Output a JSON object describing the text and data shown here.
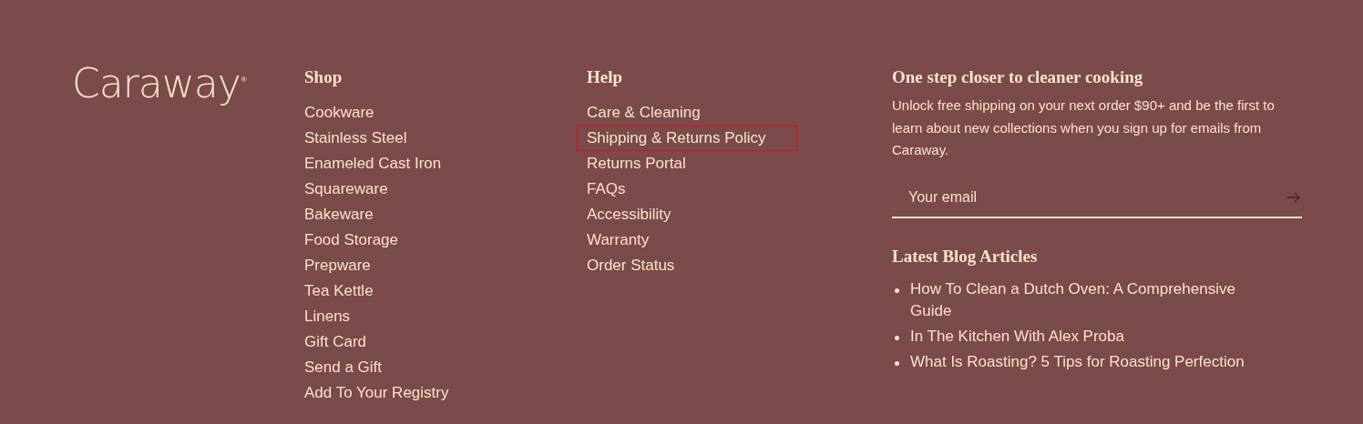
{
  "logo": {
    "name": "Caraway",
    "mark": "®"
  },
  "columns": [
    {
      "title": "Shop",
      "links": [
        {
          "label": "Cookware",
          "highlighted": false
        },
        {
          "label": "Stainless Steel",
          "highlighted": false
        },
        {
          "label": "Enameled Cast Iron",
          "highlighted": false
        },
        {
          "label": "Squareware",
          "highlighted": false
        },
        {
          "label": "Bakeware",
          "highlighted": false
        },
        {
          "label": "Food Storage",
          "highlighted": false
        },
        {
          "label": "Prepware",
          "highlighted": false
        },
        {
          "label": "Tea Kettle",
          "highlighted": false
        },
        {
          "label": "Linens",
          "highlighted": false
        },
        {
          "label": "Gift Card",
          "highlighted": false
        },
        {
          "label": "Send a Gift",
          "highlighted": false
        },
        {
          "label": "Add To Your Registry",
          "highlighted": false
        }
      ]
    },
    {
      "title": "Help",
      "links": [
        {
          "label": "Care & Cleaning",
          "highlighted": false
        },
        {
          "label": "Shipping & Returns Policy",
          "highlighted": true
        },
        {
          "label": "Returns Portal",
          "highlighted": false
        },
        {
          "label": "FAQs",
          "highlighted": false
        },
        {
          "label": "Accessibility",
          "highlighted": false
        },
        {
          "label": "Warranty",
          "highlighted": false
        },
        {
          "label": "Order Status",
          "highlighted": false
        }
      ]
    }
  ],
  "newsletter": {
    "title": "One step closer to cleaner cooking",
    "text": "Unlock free shipping on your next order $90+ and be the first to learn about new collections when you sign up for emails from Caraway.",
    "email": {
      "placeholder": "Your email"
    }
  },
  "blog": {
    "title": "Latest Blog Articles",
    "articles": [
      "How To Clean a Dutch Oven: A Comprehensive Guide",
      "In The Kitchen With Alex Proba",
      "What Is Roasting? 5 Tips for Roasting Perfection"
    ]
  }
}
